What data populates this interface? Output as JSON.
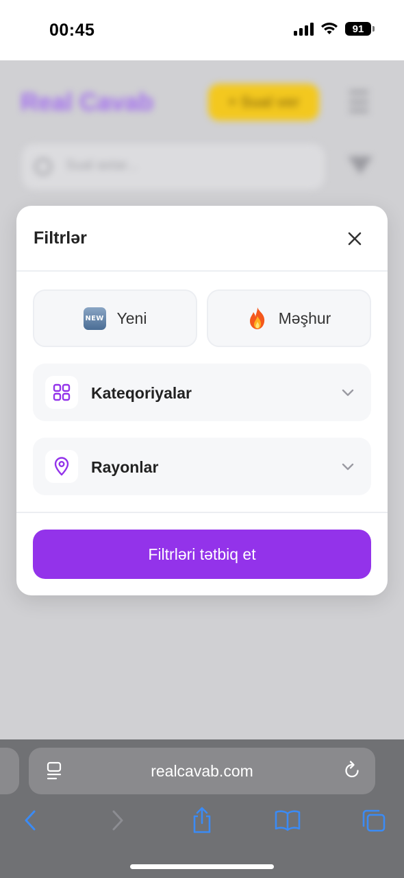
{
  "status_bar": {
    "time": "00:45",
    "battery": "91"
  },
  "background_page": {
    "logo": "Real Cavab",
    "ask_button": "+ Sual ver",
    "search_placeholder": "Sual axtar..."
  },
  "modal": {
    "title": "Filtrlər",
    "chips": [
      {
        "label": "Yeni",
        "icon": "new-badge-icon"
      },
      {
        "label": "Məşhur",
        "icon": "fire-icon"
      }
    ],
    "sections": [
      {
        "label": "Kateqoriyalar",
        "icon": "grid-icon"
      },
      {
        "label": "Rayonlar",
        "icon": "location-pin-icon"
      }
    ],
    "apply_button": "Filtrləri tətbiq et",
    "accent_color": "#9333ea"
  },
  "browser": {
    "url": "realcavab.com"
  }
}
